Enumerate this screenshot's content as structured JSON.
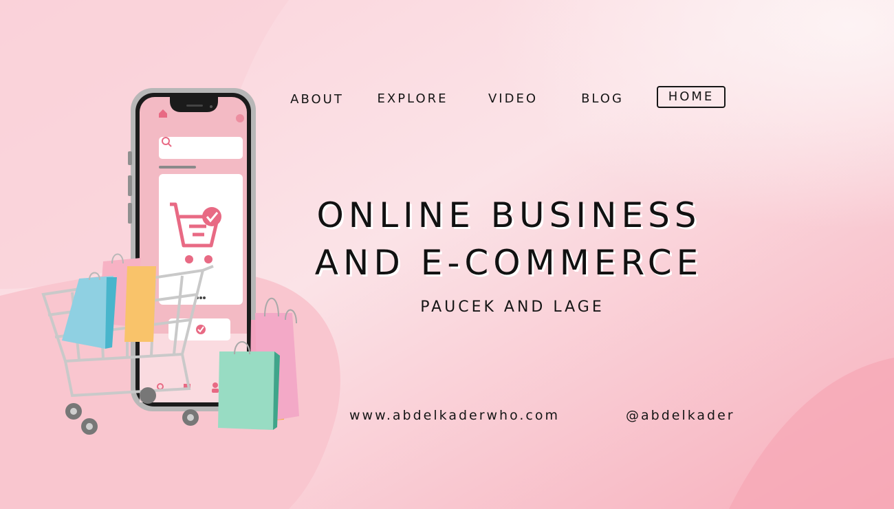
{
  "nav": {
    "items": [
      "ABOUT",
      "EXPLORE",
      "VIDEO",
      "BLOG"
    ],
    "home_label": "HOME"
  },
  "hero": {
    "title_line1": "ONLINE BUSINESS",
    "title_line2": "AND E-COMMERCE",
    "subtitle": "PAUCEK AND LAGE"
  },
  "footer": {
    "website": "www.abdelkaderwho.com",
    "handle": "@abdelkader"
  },
  "colors": {
    "background": "#f8d3da",
    "accent_pink": "#f4a9b7",
    "text": "#151515"
  },
  "icons": [
    "home-icon",
    "search-icon",
    "cart-icon",
    "check-icon",
    "profile-icon",
    "shopping-bag-icon",
    "shopping-cart-icon"
  ]
}
